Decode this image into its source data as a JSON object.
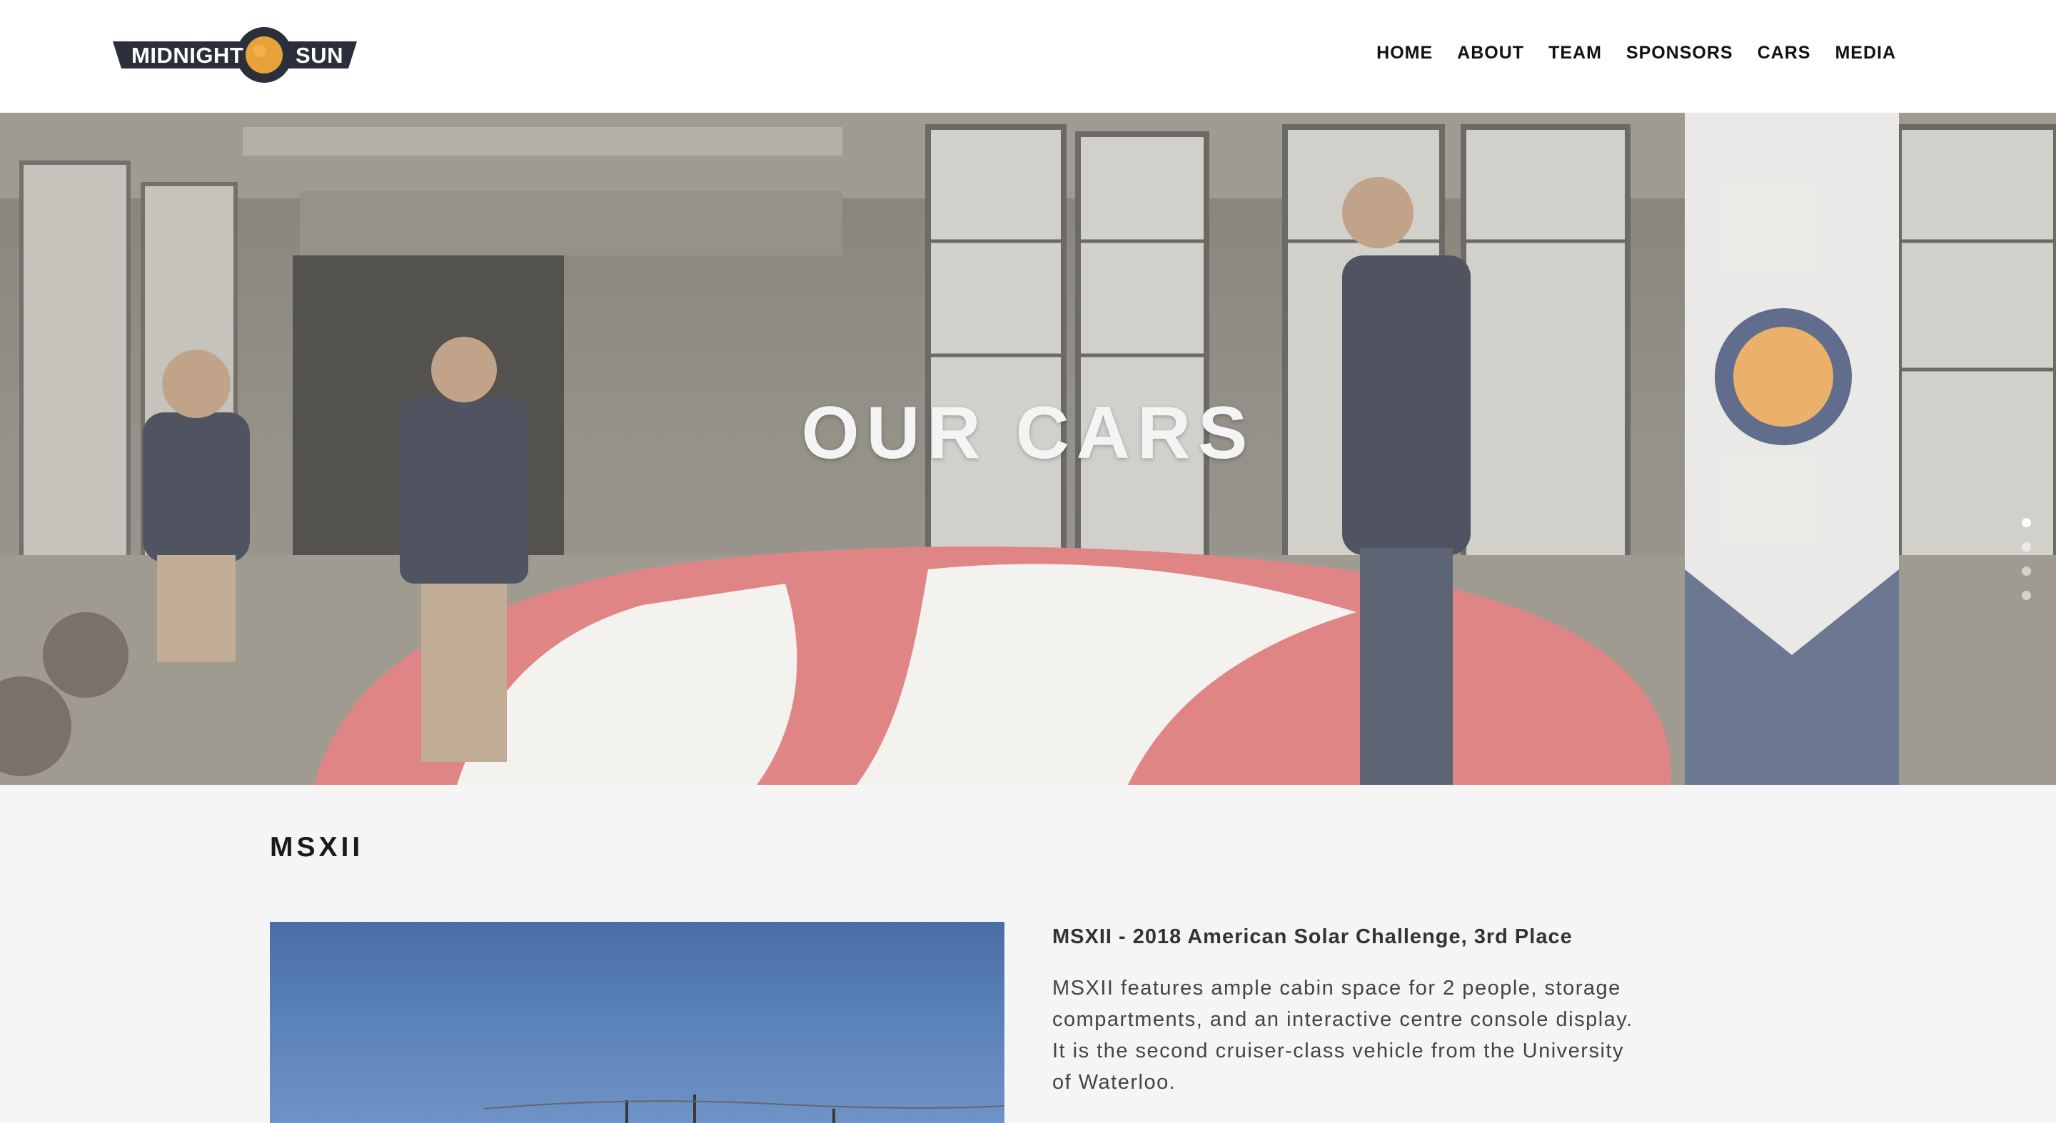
{
  "logo": {
    "left_text": "MIDNIGHT",
    "right_text": "SUN"
  },
  "nav": {
    "items": [
      "HOME",
      "ABOUT",
      "TEAM",
      "SPONSORS",
      "CARS",
      "MEDIA"
    ]
  },
  "hero": {
    "title": "OUR CARS",
    "slides": 4,
    "active_slide": 1
  },
  "section": {
    "title": "MSXII",
    "subhead": "MSXII - 2018 American Solar Challenge, 3rd Place",
    "description": "MSXII features ample cabin space for 2 people, storage compartments, and an interactive centre console display. It is the second cruiser-class vehicle from the University of Waterloo."
  },
  "colors": {
    "logo_dark": "#2b2f3a",
    "logo_sun": "#e8a23a",
    "flag_red": "#c95a5c"
  }
}
